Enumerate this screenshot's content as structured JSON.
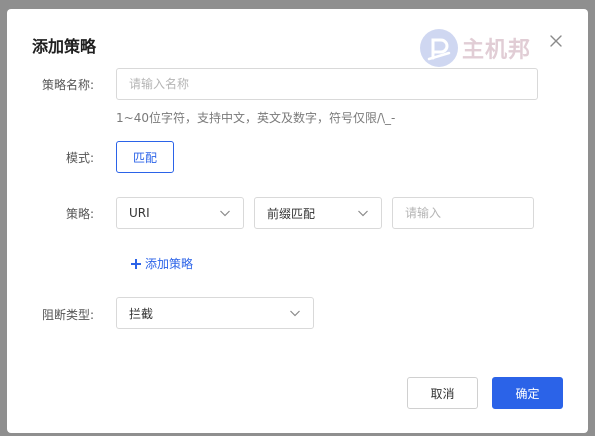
{
  "dialog": {
    "title": "添加策略",
    "watermark_text": "主机邦"
  },
  "form": {
    "name": {
      "label": "策略名称:",
      "placeholder": "请输入名称",
      "value": "",
      "hint": "1~40位字符，支持中文，英文及数字，符号仅限/\\_-"
    },
    "mode": {
      "label": "模式:",
      "button_label": "匹配"
    },
    "strategy": {
      "label": "策略:",
      "field_select": "URI",
      "match_select": "前缀匹配",
      "value_placeholder": "请输入",
      "add_label": "添加策略"
    },
    "block_type": {
      "label": "阻断类型:",
      "value": "拦截"
    }
  },
  "footer": {
    "cancel_label": "取消",
    "confirm_label": "确定"
  },
  "colors": {
    "accent": "#2b63e8",
    "overlay": "#8f8f8f"
  },
  "icons": {
    "close": "close-icon",
    "chevron": "chevron-down-icon",
    "plus": "plus-icon",
    "watermark_logo": "p-logo-icon"
  }
}
